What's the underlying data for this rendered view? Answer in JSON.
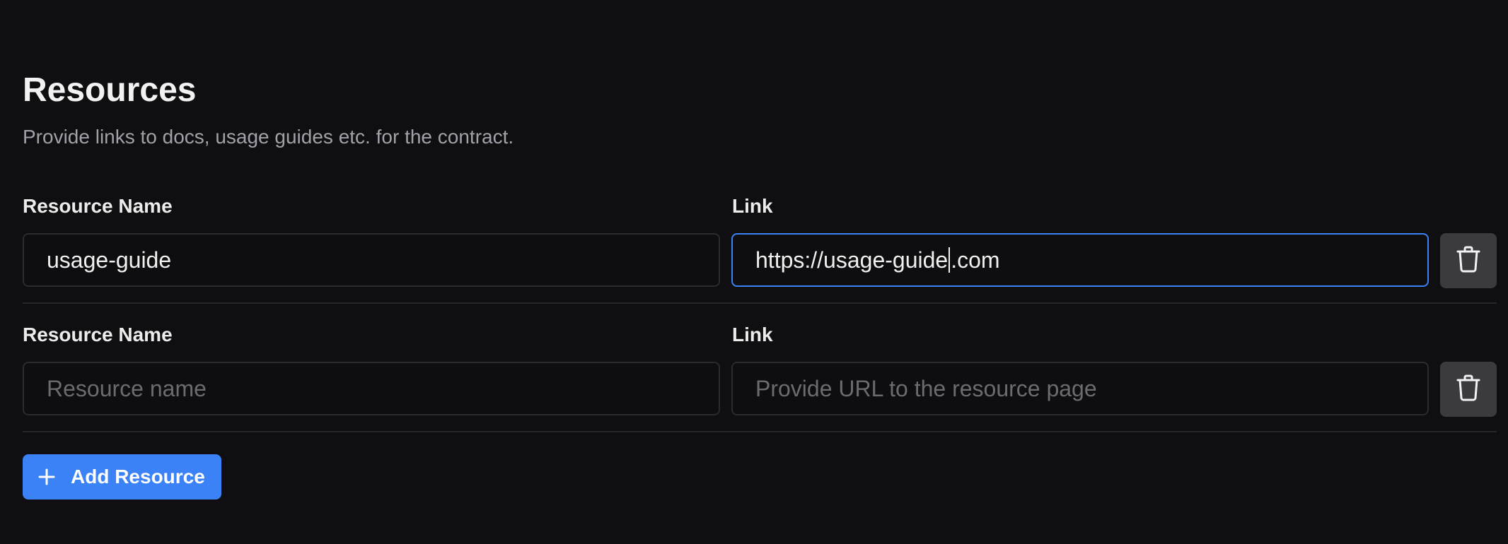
{
  "section": {
    "title": "Resources",
    "subtitle": "Provide links to docs, usage guides etc. for the contract."
  },
  "resources": [
    {
      "name_label": "Resource Name",
      "link_label": "Link",
      "name_value": "usage-guide",
      "link_value_before_caret": "https://usage-guide",
      "link_value_after_caret": ".com",
      "name_placeholder": "Resource name",
      "link_placeholder": "Provide URL to the resource page"
    },
    {
      "name_label": "Resource Name",
      "link_label": "Link",
      "name_value": "",
      "link_value": "",
      "name_placeholder": "Resource name",
      "link_placeholder": "Provide URL to the resource page"
    }
  ],
  "actions": {
    "add_label": "Add Resource",
    "add_icon": "plus-icon",
    "delete_icon": "trash-icon"
  },
  "colors": {
    "background": "#0f0f11",
    "accent": "#3b82f6",
    "input_border": "#2a2a2f",
    "delete_bg": "#3b3b3f"
  }
}
